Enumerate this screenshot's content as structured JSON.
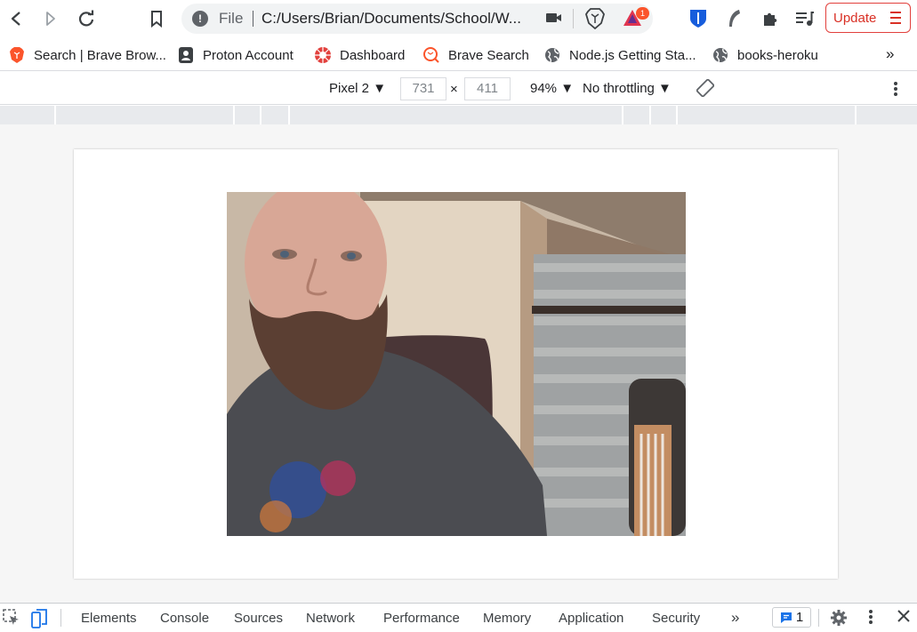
{
  "toolbar": {
    "back_icon": "back-icon",
    "forward_icon": "forward-icon",
    "reload_icon": "reload-icon",
    "bookmark_icon": "bookmark-icon",
    "omnibox": {
      "scheme_label": "File",
      "url": "C:/Users/Brian/Documents/School/W...",
      "rewards_badge": "1"
    },
    "update_label": "Update",
    "accent_color": "#d93025"
  },
  "bookmarks": [
    {
      "label": "Search | Brave Brow...",
      "icon": "brave-lion-icon"
    },
    {
      "label": "Proton Account",
      "icon": "proton-icon"
    },
    {
      "label": "Dashboard",
      "icon": "dashboard-icon"
    },
    {
      "label": "Brave Search",
      "icon": "brave-search-icon"
    },
    {
      "label": "Node.js Getting Sta...",
      "icon": "globe-icon"
    },
    {
      "label": "books-heroku",
      "icon": "globe-icon"
    }
  ],
  "bookmarks_more": "»",
  "device_toolbar": {
    "device": "Pixel 2 ▼",
    "width": "731",
    "times": "×",
    "height": "411",
    "zoom": "94% ▼",
    "throttling": "No throttling ▼"
  },
  "viewport": {
    "image_description_icon": "webcam-photo"
  },
  "devtools": {
    "tabs": [
      "Elements",
      "Console",
      "Sources",
      "Network",
      "Performance",
      "Memory",
      "Application",
      "Security"
    ],
    "overflow": "»",
    "issues_count": "1"
  }
}
